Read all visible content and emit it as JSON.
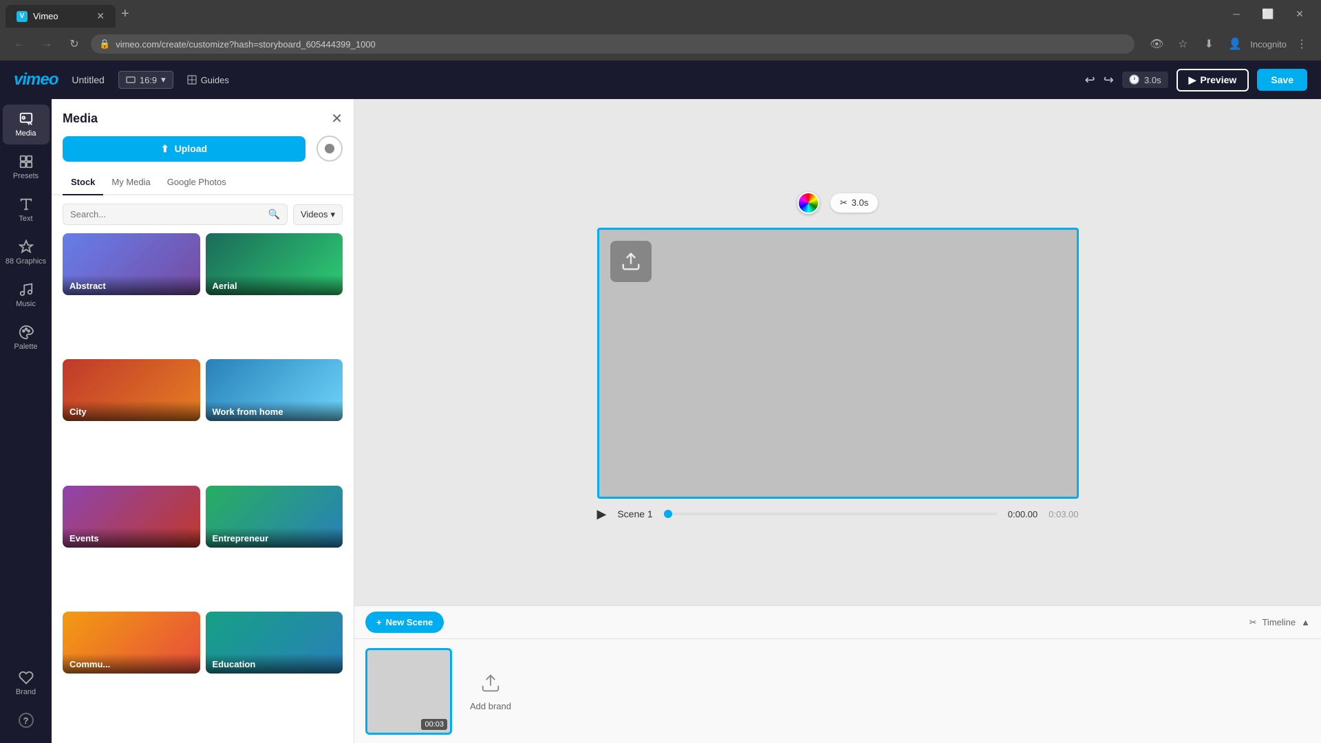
{
  "browser": {
    "tab_label": "Vimeo",
    "tab_favicon": "V",
    "url": "vimeo.com/create/customize?hash=storyboard_605444399_1000",
    "incognito_label": "Incognito"
  },
  "header": {
    "logo": "vimeo",
    "title": "Untitled",
    "aspect_ratio": "16:9",
    "guides_label": "Guides",
    "time_label": "3.0s",
    "preview_label": "Preview",
    "save_label": "Save"
  },
  "nav": {
    "items": [
      {
        "id": "media",
        "label": "Media",
        "active": true
      },
      {
        "id": "presets",
        "label": "Presets",
        "active": false
      },
      {
        "id": "text",
        "label": "Text",
        "active": false
      },
      {
        "id": "graphics",
        "label": "Graphics",
        "active": false
      },
      {
        "id": "music",
        "label": "Music",
        "active": false
      },
      {
        "id": "palette",
        "label": "Palette",
        "active": false
      },
      {
        "id": "brand",
        "label": "Brand",
        "active": false
      }
    ],
    "help_label": "?"
  },
  "media_panel": {
    "title": "Media",
    "upload_label": "Upload",
    "tabs": [
      {
        "id": "stock",
        "label": "Stock",
        "active": true
      },
      {
        "id": "my-media",
        "label": "My Media",
        "active": false
      },
      {
        "id": "google-photos",
        "label": "Google Photos",
        "active": false
      }
    ],
    "search_placeholder": "Search...",
    "filter_label": "Videos",
    "categories": [
      {
        "id": "abstract",
        "label": "Abstract",
        "color_class": "mock-abstract"
      },
      {
        "id": "aerial",
        "label": "Aerial",
        "color_class": "mock-aerial"
      },
      {
        "id": "city",
        "label": "City",
        "color_class": "mock-city"
      },
      {
        "id": "work-from-home",
        "label": "Work from home",
        "color_class": "mock-wfh"
      },
      {
        "id": "events",
        "label": "Events",
        "color_class": "mock-events"
      },
      {
        "id": "entrepreneur",
        "label": "Entrepreneur",
        "color_class": "mock-entrepreneur"
      },
      {
        "id": "community",
        "label": "Commu...",
        "color_class": "mock-commu"
      },
      {
        "id": "education",
        "label": "Education",
        "color_class": "mock-education"
      }
    ]
  },
  "canvas": {
    "scissors_label": "3.0s"
  },
  "timeline": {
    "play_icon": "▶",
    "scene_label": "Scene 1",
    "time_current": "0:00.00",
    "time_total": "0:03.00",
    "scene_time": "00:03",
    "new_scene_label": "New Scene",
    "timeline_label": "Timeline",
    "add_brand_label": "Add brand"
  }
}
